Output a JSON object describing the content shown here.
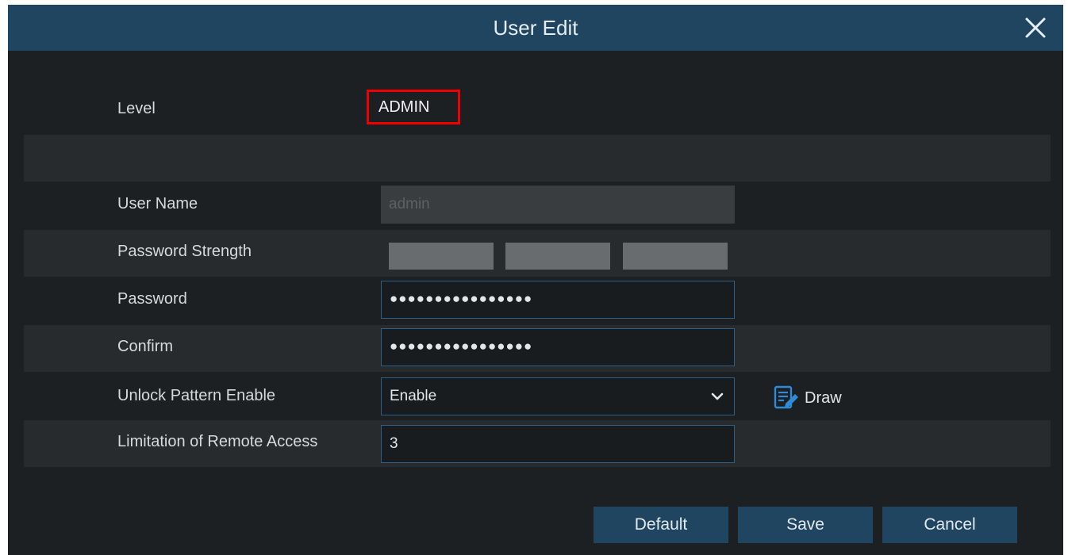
{
  "dialog": {
    "title": "User Edit"
  },
  "icons": {
    "close": "close-icon",
    "dropdown": "chevron-down-icon",
    "draw": "pencil-document-icon"
  },
  "colors": {
    "title_bar": "#1f4560",
    "background": "#1c2023",
    "row_band": "#272b2e",
    "highlight_box": "#f00000",
    "input_border": "#2d5f86",
    "draw_icon": "#2f8bd7"
  },
  "form": {
    "level": {
      "label": "Level",
      "value": "ADMIN"
    },
    "user_name": {
      "label": "User Name",
      "value": "admin"
    },
    "password_strength": {
      "label": "Password Strength",
      "segments_filled": 0,
      "segments_total": 3
    },
    "password": {
      "label": "Password",
      "value": "●●●●●●●●●●●●●●●●"
    },
    "confirm": {
      "label": "Confirm",
      "value": "●●●●●●●●●●●●●●●●"
    },
    "unlock_pattern": {
      "label": "Unlock Pattern Enable",
      "value": "Enable",
      "draw_label": "Draw"
    },
    "remote_access": {
      "label": "Limitation of Remote Access",
      "value": "3"
    }
  },
  "buttons": {
    "default": "Default",
    "save": "Save",
    "cancel": "Cancel"
  }
}
